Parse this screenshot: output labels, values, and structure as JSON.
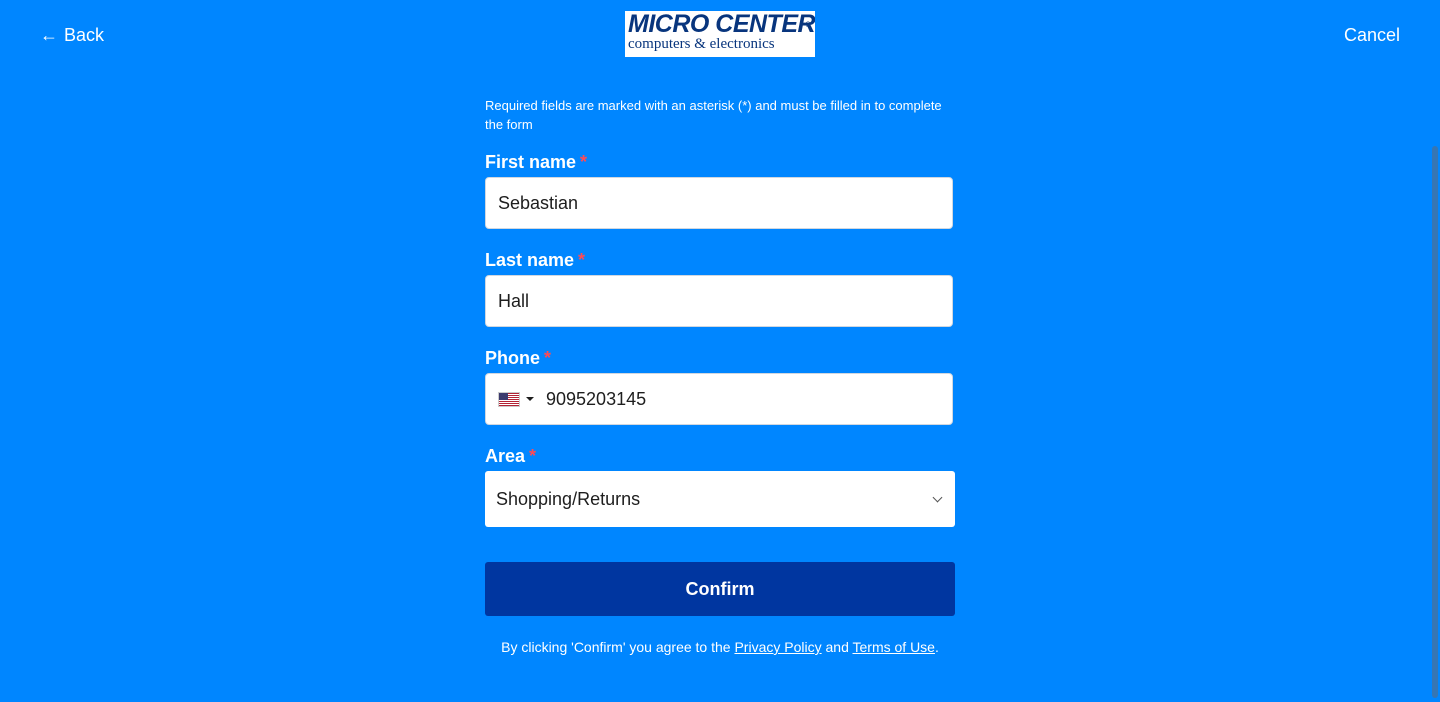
{
  "header": {
    "back_label": "Back",
    "cancel_label": "Cancel",
    "logo_brand": "MICRO CENTER",
    "logo_registered": "®",
    "logo_tagline": "computers & electronics"
  },
  "form": {
    "notice": "Required fields are marked with an asterisk (*) and must be filled in to complete the form",
    "required_marker": "*",
    "first_name": {
      "label": "First name",
      "value": "Sebastian"
    },
    "last_name": {
      "label": "Last name",
      "value": "Hall"
    },
    "phone": {
      "label": "Phone",
      "value": "9095203145",
      "country_icon": "us-flag-icon"
    },
    "area": {
      "label": "Area",
      "value": "Shopping/Returns"
    },
    "confirm_label": "Confirm"
  },
  "legal": {
    "prefix": "By clicking 'Confirm' you agree to the",
    "privacy_link": "Privacy Policy",
    "and": "and",
    "terms_link": "Terms of Use",
    "suffix": "."
  },
  "colors": {
    "background": "#0086ff",
    "confirm_button": "#0036a0",
    "required_asterisk": "#ff4a55",
    "logo_text": "#08357d"
  }
}
